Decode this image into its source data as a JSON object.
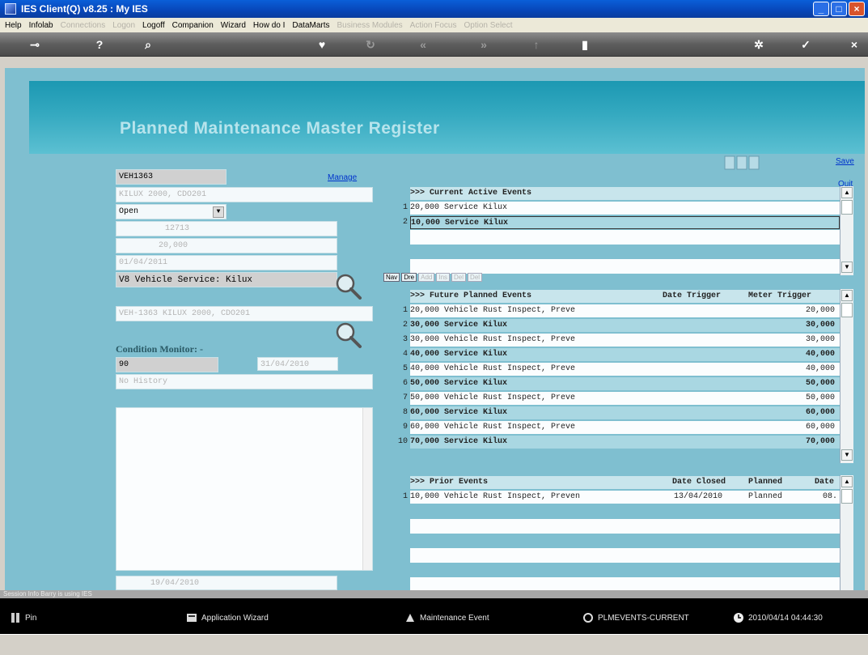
{
  "window": {
    "title": "IES Client(Q) v8.25 : My IES"
  },
  "menu": [
    {
      "label": "Help",
      "enabled": true
    },
    {
      "label": "Infolab",
      "enabled": true
    },
    {
      "label": "Connections",
      "enabled": false
    },
    {
      "label": "Logon",
      "enabled": false
    },
    {
      "label": "Logoff",
      "enabled": true
    },
    {
      "label": "Companion",
      "enabled": true
    },
    {
      "label": "Wizard",
      "enabled": true
    },
    {
      "label": "How do I",
      "enabled": true
    },
    {
      "label": "DataMarts",
      "enabled": true
    },
    {
      "label": "Business Modules",
      "enabled": false
    },
    {
      "label": "Action Focus",
      "enabled": false
    },
    {
      "label": "Option Select",
      "enabled": false
    }
  ],
  "page_title": "Planned Maintenance Master Register",
  "links": {
    "manage": "Manage",
    "save": "Save",
    "quit": "Quit"
  },
  "form": {
    "asset_code": "VEH1363",
    "description": "KILUX 2000, CDO201",
    "state": "Open",
    "latest_meter": "12713",
    "trigger_at": "20,000",
    "date_trigger": "01/04/2011",
    "event_group": "V8 Vehicle Service: Kilux",
    "asset": "VEH-1363 KILUX 2000, CDO201",
    "condition_monitor_heading": "Condition Monitor: -",
    "condition_monitor": "90",
    "condition_date": "31/04/2010",
    "latest_status": "No History",
    "bottom_date": "19/04/2010"
  },
  "current_events": {
    "header": ">>> Current Active Events",
    "rows": [
      {
        "n": "1",
        "text": "20,000 Service Kilux"
      },
      {
        "n": "2",
        "text": "10,000 Service Kilux"
      }
    ]
  },
  "tabs": [
    "Nav",
    "Dre",
    "Add",
    "Ins",
    "Del",
    "Del"
  ],
  "future_events": {
    "header": ">>> Future Planned Events",
    "col_date": "Date Trigger",
    "col_meter": "Meter Trigger",
    "rows": [
      {
        "n": "1",
        "text": "20,000 Vehicle Rust Inspect, Preve",
        "meter": "20,000"
      },
      {
        "n": "2",
        "text": "30,000 Service Kilux",
        "meter": "30,000"
      },
      {
        "n": "3",
        "text": "30,000 Vehicle Rust Inspect, Preve",
        "meter": "30,000"
      },
      {
        "n": "4",
        "text": "40,000 Service Kilux",
        "meter": "40,000"
      },
      {
        "n": "5",
        "text": "40,000 Vehicle Rust Inspect, Preve",
        "meter": "40,000"
      },
      {
        "n": "6",
        "text": "50,000 Service Kilux",
        "meter": "50,000"
      },
      {
        "n": "7",
        "text": "50,000 Vehicle Rust Inspect, Preve",
        "meter": "50,000"
      },
      {
        "n": "8",
        "text": "60,000 Service Kilux",
        "meter": "60,000"
      },
      {
        "n": "9",
        "text": "60,000 Vehicle Rust Inspect, Preve",
        "meter": "60,000"
      },
      {
        "n": "10",
        "text": "70,000 Service Kilux",
        "meter": "70,000"
      }
    ]
  },
  "prior_events": {
    "header": ">>> Prior Events",
    "col_closed": "Date Closed",
    "col_planned": "Planned",
    "col_date": "Date",
    "rows": [
      {
        "n": "1",
        "text": "10,000 Vehicle Rust Inspect, Preven",
        "closed": "13/04/2010",
        "planned": "Planned",
        "date": "08."
      }
    ]
  },
  "statusline": "Session Info Barry is using IES",
  "taskbar": {
    "pin": "Pin",
    "wizard": "Application Wizard",
    "event": "Maintenance Event",
    "current": "PLMEVENTS-CURRENT",
    "datetime": "2010/04/14   04:44:30"
  }
}
